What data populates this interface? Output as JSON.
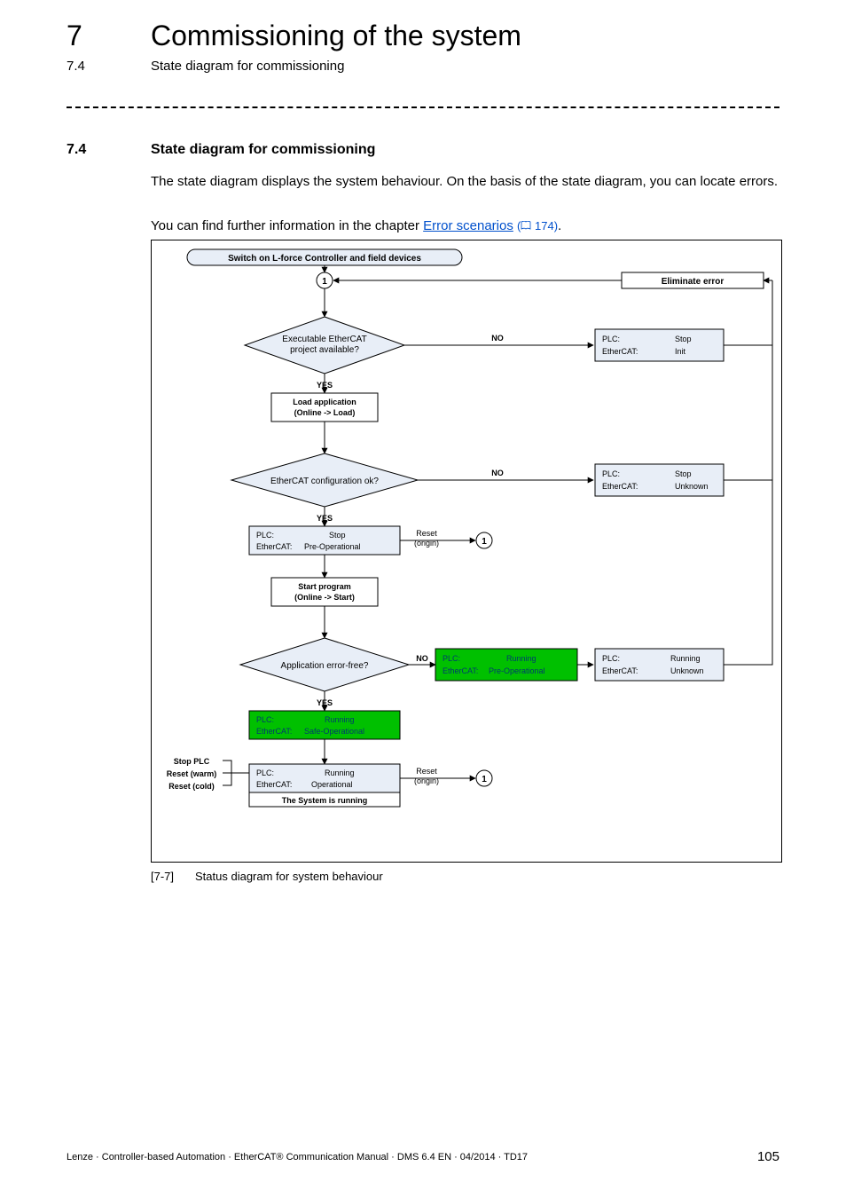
{
  "header": {
    "chapter_num": "7",
    "chapter_title": "Commissioning of the system",
    "sub_num": "7.4",
    "sub_title": "State diagram for commissioning"
  },
  "section": {
    "num": "7.4",
    "title": "State diagram for commissioning",
    "para1": "The state diagram displays the system behaviour. On the basis of the state diagram, you can locate errors.",
    "para2_prefix": "You can find further information in the chapter ",
    "para2_link": "Error scenarios",
    "para2_pageref": "174",
    "para2_suffix": "."
  },
  "diagram": {
    "start": "Switch on L-force Controller and field devices",
    "eliminate": "Eliminate error",
    "node1": "1",
    "dec1_l1": "Executable EtherCAT",
    "dec1_l2": "project available?",
    "dec1_no": "NO",
    "dec1_yes": "YES",
    "state1_plc": "PLC:",
    "state1_ecat": "EtherCAT:",
    "state1_v1": "Stop",
    "state1_v2": "Init",
    "proc1_l1": "Load application",
    "proc1_l2": "(Online -> Load)",
    "dec2": "EtherCAT configuration ok?",
    "dec2_no": "NO",
    "dec2_yes": "YES",
    "state2_plc": "PLC:",
    "state2_ecat": "EtherCAT:",
    "state2_v1": "Stop",
    "state2_v2": "Unknown",
    "state3_plc": "PLC:",
    "state3_ecat": "EtherCAT:",
    "state3_v1": "Stop",
    "state3_v2": "Pre-Operational",
    "reset1_l1": "Reset",
    "reset1_l2": "(origin)",
    "conn1": "1",
    "proc2_l1": "Start program",
    "proc2_l2": "(Online -> Start)",
    "dec3": "Application error-free?",
    "dec3_no": "NO",
    "dec3_yes": "YES",
    "state4_plc": "PLC:",
    "state4_ecat": "EtherCAT:",
    "state4_v1": "Running",
    "state4_v2": "Pre-Operational",
    "state5_plc": "PLC:",
    "state5_ecat": "EtherCAT:",
    "state5_v1": "Running",
    "state5_v2": "Unknown",
    "state6_plc": "PLC:",
    "state6_ecat": "EtherCAT:",
    "state6_v1": "Running",
    "state6_v2": "Safe-Operational",
    "state7_plc": "PLC:",
    "state7_ecat": "EtherCAT:",
    "state7_v1": "Running",
    "state7_v2": "Operational",
    "state7_sub": "The System is running",
    "reset2_l1": "Reset",
    "reset2_l2": "(origin)",
    "conn2": "1",
    "left_l1": "Stop PLC",
    "left_l2": "Reset (warm)",
    "left_l3": "Reset (cold)"
  },
  "caption": {
    "num": "[7-7]",
    "text": "Status diagram for system behaviour"
  },
  "footer": {
    "text": "Lenze · Controller-based Automation · EtherCAT® Communication Manual · DMS 6.4 EN · 04/2014 · TD17",
    "pagenum": "105"
  },
  "chart_data": {
    "type": "flowchart",
    "nodes": [
      {
        "id": "start",
        "type": "terminator",
        "label": "Switch on L-force Controller and field devices"
      },
      {
        "id": "n1",
        "type": "connector",
        "label": "1"
      },
      {
        "id": "eliminate",
        "type": "process",
        "label": "Eliminate error"
      },
      {
        "id": "dec1",
        "type": "decision",
        "label": "Executable EtherCAT project available?"
      },
      {
        "id": "s1",
        "type": "state",
        "plc": "Stop",
        "ethercat": "Init"
      },
      {
        "id": "proc1",
        "type": "process",
        "label": "Load application (Online -> Load)"
      },
      {
        "id": "dec2",
        "type": "decision",
        "label": "EtherCAT configuration ok?"
      },
      {
        "id": "s2",
        "type": "state",
        "plc": "Stop",
        "ethercat": "Unknown"
      },
      {
        "id": "s3",
        "type": "state",
        "plc": "Stop",
        "ethercat": "Pre-Operational"
      },
      {
        "id": "r1",
        "type": "event",
        "label": "Reset (origin)"
      },
      {
        "id": "c1",
        "type": "connector",
        "label": "1"
      },
      {
        "id": "proc2",
        "type": "process",
        "label": "Start program (Online -> Start)"
      },
      {
        "id": "dec3",
        "type": "decision",
        "label": "Application error-free?"
      },
      {
        "id": "s4",
        "type": "state-run",
        "plc": "Running",
        "ethercat": "Pre-Operational"
      },
      {
        "id": "s5",
        "type": "state",
        "plc": "Running",
        "ethercat": "Unknown"
      },
      {
        "id": "s6",
        "type": "state-run",
        "plc": "Running",
        "ethercat": "Safe-Operational"
      },
      {
        "id": "s7",
        "type": "state-final",
        "plc": "Running",
        "ethercat": "Operational",
        "note": "The System is running"
      },
      {
        "id": "r2",
        "type": "event",
        "label": "Reset (origin)"
      },
      {
        "id": "c2",
        "type": "connector",
        "label": "1"
      },
      {
        "id": "left",
        "type": "event-group",
        "labels": [
          "Stop PLC",
          "Reset (warm)",
          "Reset (cold)"
        ]
      }
    ],
    "edges": [
      {
        "from": "start",
        "to": "n1"
      },
      {
        "from": "eliminate",
        "to": "n1"
      },
      {
        "from": "n1",
        "to": "dec1"
      },
      {
        "from": "dec1",
        "to": "s1",
        "label": "NO"
      },
      {
        "from": "s1",
        "to": "eliminate"
      },
      {
        "from": "dec1",
        "to": "proc1",
        "label": "YES"
      },
      {
        "from": "proc1",
        "to": "dec2"
      },
      {
        "from": "dec2",
        "to": "s2",
        "label": "NO"
      },
      {
        "from": "s2",
        "to": "eliminate"
      },
      {
        "from": "dec2",
        "to": "s3",
        "label": "YES"
      },
      {
        "from": "s3",
        "to": "c1",
        "via": "r1"
      },
      {
        "from": "s3",
        "to": "proc2"
      },
      {
        "from": "proc2",
        "to": "dec3"
      },
      {
        "from": "dec3",
        "to": "s4",
        "label": "NO"
      },
      {
        "from": "s4",
        "to": "s5"
      },
      {
        "from": "s5",
        "to": "eliminate"
      },
      {
        "from": "dec3",
        "to": "s6",
        "label": "YES"
      },
      {
        "from": "s6",
        "to": "s7"
      },
      {
        "from": "s7",
        "to": "c2",
        "via": "r2"
      },
      {
        "from": "left",
        "to": "s7"
      }
    ]
  }
}
